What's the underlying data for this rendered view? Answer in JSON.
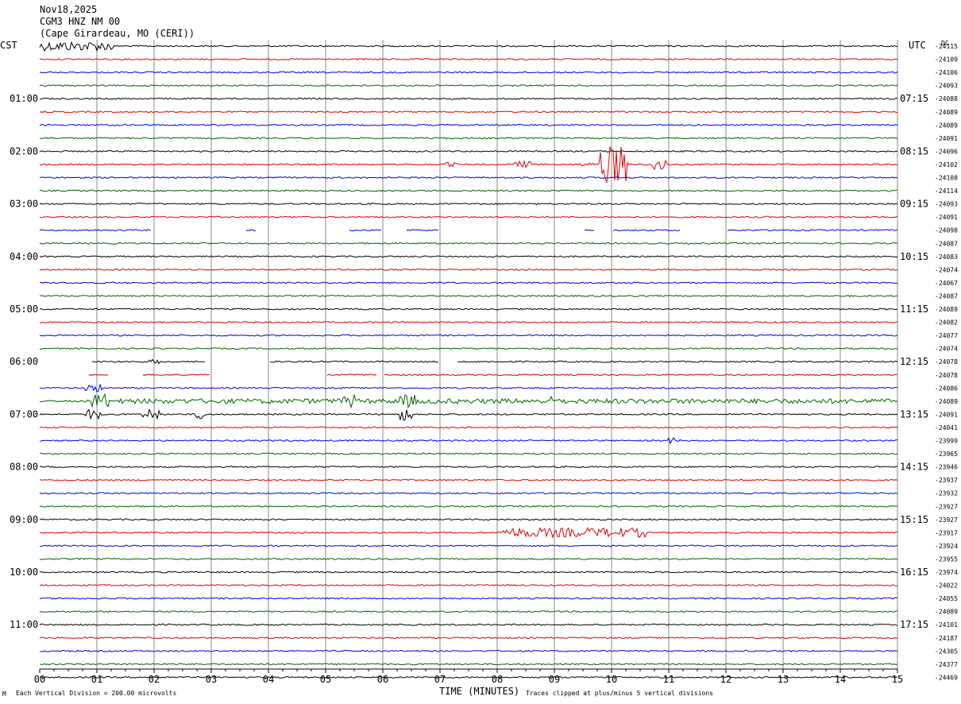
{
  "header": {
    "date": "Nov18,2025",
    "station": "CGM3 HNZ NM 00",
    "location": "(Cape Girardeau, MO (CERI))",
    "left_tz": "CST",
    "right_tz": "UTC",
    "dc_label": "DC"
  },
  "footer": {
    "scale_note": "Each Vertical Division =  200.00 microvolts",
    "xlabel": "TIME (MINUTES)",
    "clip_note": "Traces clipped at plus/minus 5 vertical divisions",
    "corner_mark": "M"
  },
  "chart_data": {
    "type": "line",
    "title": "CGM3 HNZ NM 00",
    "xlabel": "TIME (MINUTES)",
    "xlim": [
      0,
      15
    ],
    "x_ticks": [
      "00",
      "01",
      "02",
      "03",
      "04",
      "05",
      "06",
      "07",
      "08",
      "09",
      "10",
      "11",
      "12",
      "13",
      "14",
      "15"
    ],
    "grid": true,
    "trace_colors": [
      "#000000",
      "#e00000",
      "#0000e0",
      "#006400"
    ],
    "left_hour_labels": [
      "01:00",
      "02:00",
      "03:00",
      "04:00",
      "05:00",
      "06:00",
      "07:00",
      "08:00",
      "09:00",
      "10:00",
      "11:00"
    ],
    "right_hour_labels": [
      "07:15",
      "08:15",
      "09:15",
      "10:15",
      "11:15",
      "12:15",
      "13:15",
      "14:15",
      "15:15",
      "16:15",
      "17:15"
    ],
    "row_dc_values": [
      "-24115",
      "-24109",
      "-24106",
      "-24093",
      "-24088",
      "-24089",
      "-24089",
      "-24091",
      "-24096",
      "-24102",
      "-24108",
      "-24114",
      "-24093",
      "-24091",
      "-24098",
      "-24087",
      "-24083",
      "-24074",
      "-24067",
      "-24087",
      "-24089",
      "-24082",
      "-24077",
      "-24074",
      "-24078",
      "-24078",
      "-24086",
      "-24089",
      "-24091",
      "-24041",
      "-23999",
      "-23965",
      "-23946",
      "-23937",
      "-23932",
      "-23927",
      "-23927",
      "-23917",
      "-23924",
      "-23955",
      "-23974",
      "-24022",
      "-24055",
      "-24089",
      "-24101",
      "-24187",
      "-24305",
      "-24377",
      "-24469"
    ]
  }
}
